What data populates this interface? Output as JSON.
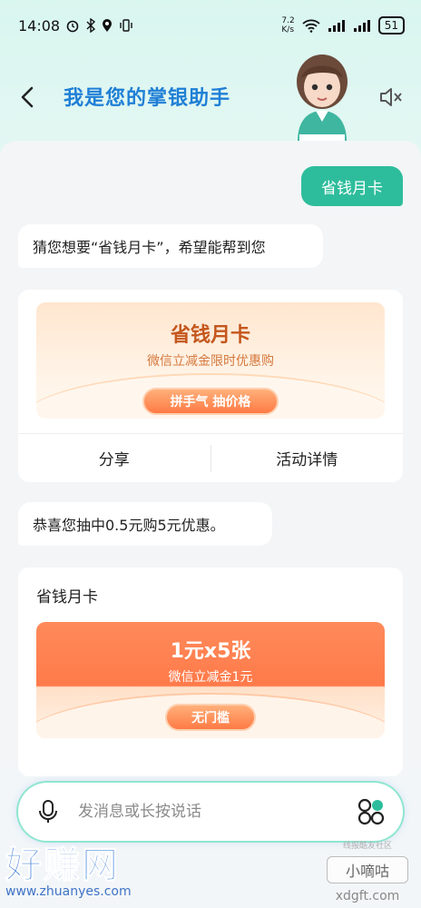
{
  "status": {
    "time": "14:08",
    "net_speed_value": "7.2",
    "net_speed_unit": "K/s",
    "battery": "51"
  },
  "header": {
    "title": "我是您的掌银助手"
  },
  "chat": {
    "user_message": "省钱月卡",
    "bot_message_1": "猜您想要“省钱月卡”，希望能帮到您",
    "card1": {
      "title": "省钱月卡",
      "subtitle": "微信立减金限时优惠购",
      "button": "拼手气 抽价格",
      "action_share": "分享",
      "action_details": "活动详情"
    },
    "bot_message_2": "恭喜您抽中0.5元购5元优惠。",
    "card2": {
      "header": "省钱月卡",
      "title": "1元x5张",
      "subtitle": "微信立减金1元",
      "button": "无门槛"
    }
  },
  "input": {
    "placeholder": "发消息或长按说话"
  },
  "watermark": {
    "left_big": "好赚网",
    "left_small": "www.zhuanyes.com",
    "right_small": "线报酷友社区",
    "right_mid": "小嘀咕",
    "right_url": "xdgft.com"
  },
  "colors": {
    "accent": "#2ebd9c",
    "title": "#1f7fd6",
    "coupon_orange": "#ff7a45"
  }
}
